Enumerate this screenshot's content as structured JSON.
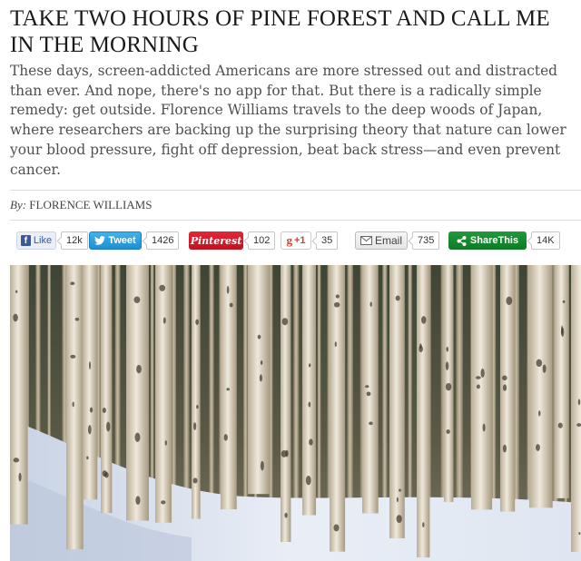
{
  "article": {
    "headline": "TAKE TWO HOURS OF PINE FOREST AND CALL ME IN THE MORNING",
    "dek": "These days, screen-addicted Americans are more stressed out and distracted than ever. And nope, there's no app for that. But there is a radically simple remedy: get outside. Florence Williams travels to the deep woods of Japan, where researchers are backing up the surprising theory that nature can lower your blood pressure, fight off depression, beat back stress—and even prevent cancer.",
    "byline_prefix": "By:",
    "byline_author": "FLORENCE WILLIAMS"
  },
  "share_bar": {
    "facebook": {
      "icon": "f",
      "label": "Like",
      "count": "12k"
    },
    "twitter": {
      "icon": "twitter-bird-icon",
      "label": "Tweet",
      "count": "1426"
    },
    "pinterest": {
      "label": "Pinterest",
      "count": "102"
    },
    "googleplus": {
      "icon": "g",
      "label": "+1",
      "count": "35"
    },
    "email": {
      "icon": "envelope-icon",
      "label": "Email",
      "count": "735"
    },
    "sharethis": {
      "icon": "share-icon",
      "label": "ShareThis",
      "count": "14K"
    }
  },
  "photo": {
    "subject": "aspen forest in snow"
  },
  "colors": {
    "facebook": "#3b5998",
    "twitter": "#2aa4e3",
    "pinterest": "#cb2027",
    "googleplus": "#d23f31",
    "sharethis": "#16892f"
  }
}
